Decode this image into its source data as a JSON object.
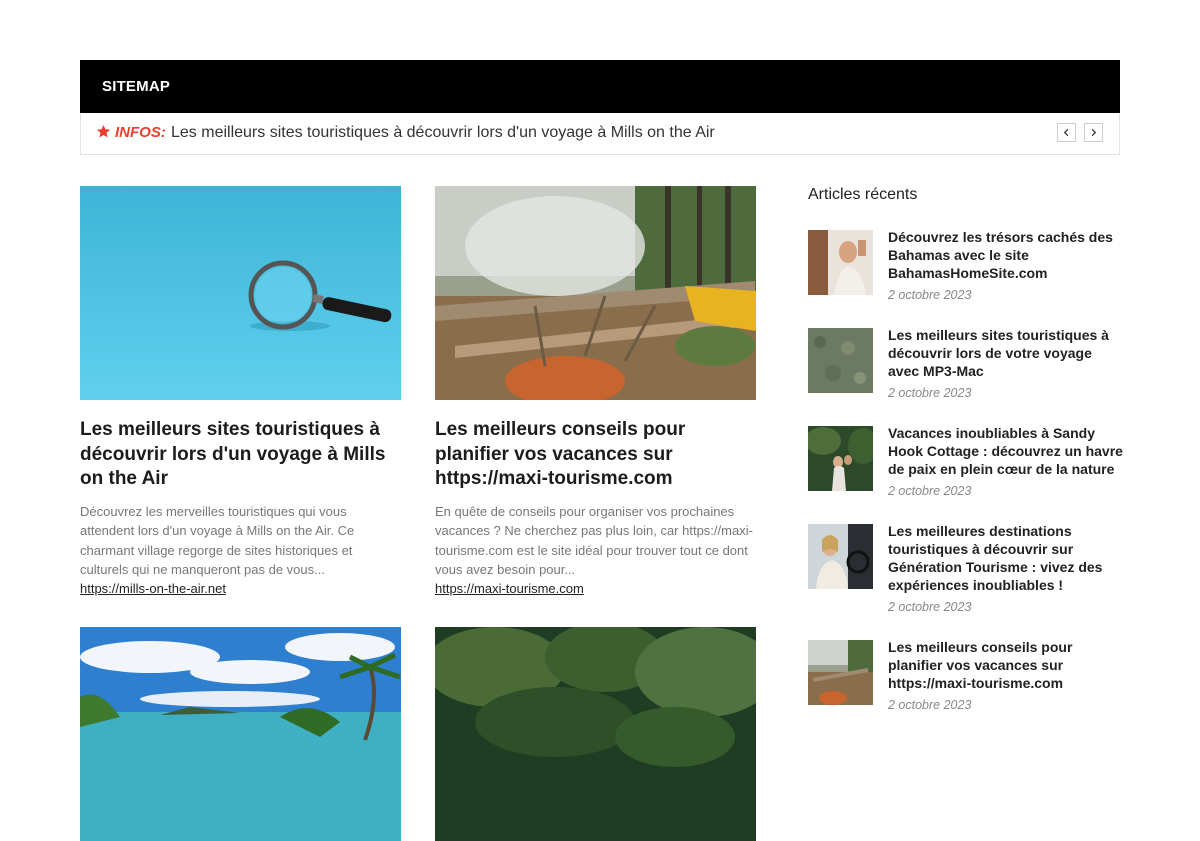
{
  "header": {
    "title": "SITEMAP"
  },
  "ticker": {
    "label": "INFOS:",
    "text": "Les meilleurs sites touristiques à découvrir lors d'un voyage à Mills on the Air",
    "accent_color": "#e8402d"
  },
  "posts": [
    {
      "title": "Les meilleurs sites touristiques à découvrir lors d'un voyage à Mills on the Air",
      "excerpt": "Découvrez les merveilles touristiques qui vous attendent lors d'un voyage à Mills on the Air. Ce charmant village regorge de sites historiques et culturels qui ne manqueront pas de vous...",
      "link": "https://mills-on-the-air.net",
      "image": "magnifying-glass-on-blue"
    },
    {
      "title": "Les meilleurs conseils pour planifier vos vacances sur https://maxi-tourisme.com",
      "excerpt": "En quête de conseils pour organiser vos prochaines vacances ? Ne cherchez pas plus loin, car https://maxi-tourisme.com est le site idéal pour trouver tout ce dont vous avez besoin pour...",
      "link": "https://maxi-tourisme.com",
      "image": "forest-clearing"
    },
    {
      "image": "tropical-beach"
    },
    {
      "image": "forest-canopy"
    }
  ],
  "sidebar": {
    "heading": "Articles récents",
    "items": [
      {
        "title": "Découvrez les trésors cachés des Bahamas avec le site BahamasHomeSite.com",
        "date": "2 octobre 2023",
        "image": "woman-photo"
      },
      {
        "title": "Les meilleurs sites touristiques à découvrir lors de votre voyage avec MP3-Mac",
        "date": "2 octobre 2023",
        "image": "aerial-forest"
      },
      {
        "title": "Vacances inoubliables à Sandy Hook Cottage : découvrez un havre de paix en plein cœur de la nature",
        "date": "2 octobre 2023",
        "image": "couple-in-nature"
      },
      {
        "title": "Les meilleures destinations touristiques à découvrir sur Génération Tourisme : vivez des expériences inoubliables !",
        "date": "2 octobre 2023",
        "image": "woman-driving"
      },
      {
        "title": "Les meilleurs conseils pour planifier vos vacances sur https://maxi-tourisme.com",
        "date": "2 octobre 2023",
        "image": "forest-clearing"
      }
    ]
  }
}
